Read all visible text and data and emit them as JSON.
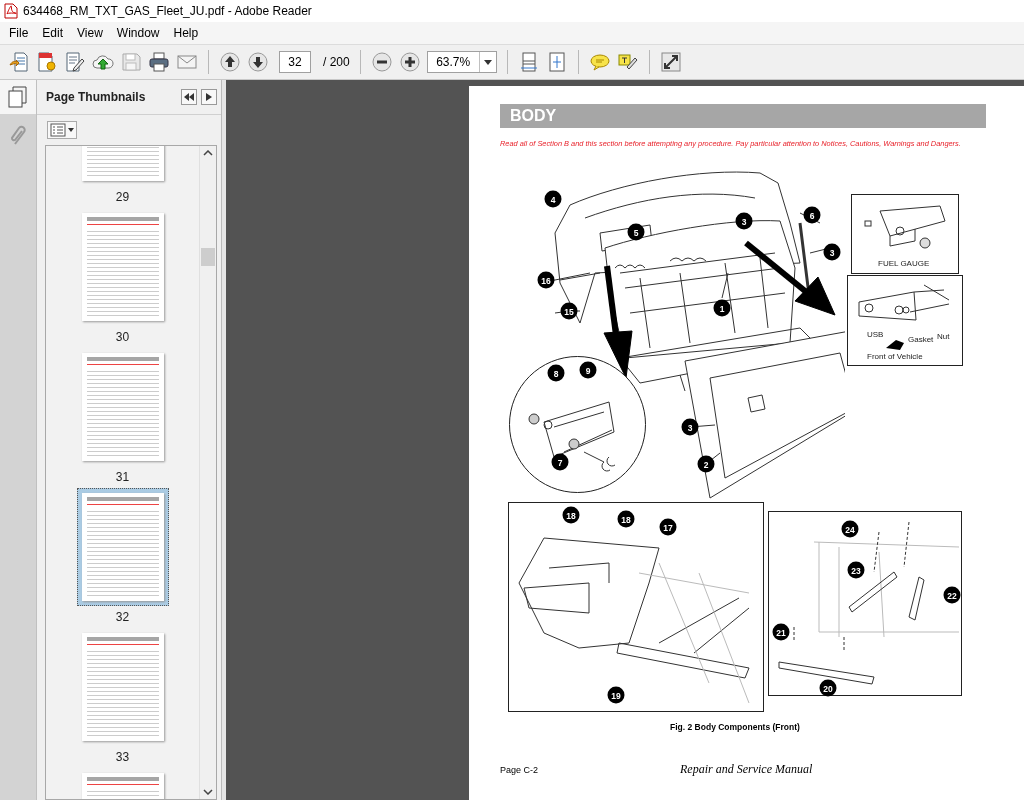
{
  "window": {
    "title": "634468_RM_TXT_GAS_Fleet_JU.pdf - Adobe Reader"
  },
  "menu": [
    "File",
    "Edit",
    "View",
    "Window",
    "Help"
  ],
  "toolbar": {
    "page": "32",
    "page_count": "/ 200",
    "zoom": "63.7%"
  },
  "sidebar": {
    "title": "Page Thumbnails",
    "thumbnails": [
      {
        "label": "29",
        "selected": false
      },
      {
        "label": "30",
        "selected": false
      },
      {
        "label": "31",
        "selected": false
      },
      {
        "label": "32",
        "selected": true
      },
      {
        "label": "33",
        "selected": false
      }
    ]
  },
  "page": {
    "heading": "BODY",
    "notice": "Read all of Section B and this section before attempting any procedure. Pay particular attention to Notices, Cautions, Warnings and Dangers.",
    "figure": {
      "callouts": [
        "4",
        "5",
        "3",
        "6",
        "3",
        "16",
        "15",
        "1",
        "8",
        "9",
        "7",
        "3",
        "2",
        "18",
        "18",
        "17",
        "19",
        "24",
        "23",
        "22",
        "21",
        "20"
      ],
      "inset_labels": [
        "FUEL GAUGE",
        "USB",
        "Gasket",
        "Nut",
        "Front of Vehicle"
      ]
    },
    "caption": "Fig. 2 Body Components (Front)",
    "page_number": "Page C-2",
    "footer": "Repair and Service Manual"
  }
}
